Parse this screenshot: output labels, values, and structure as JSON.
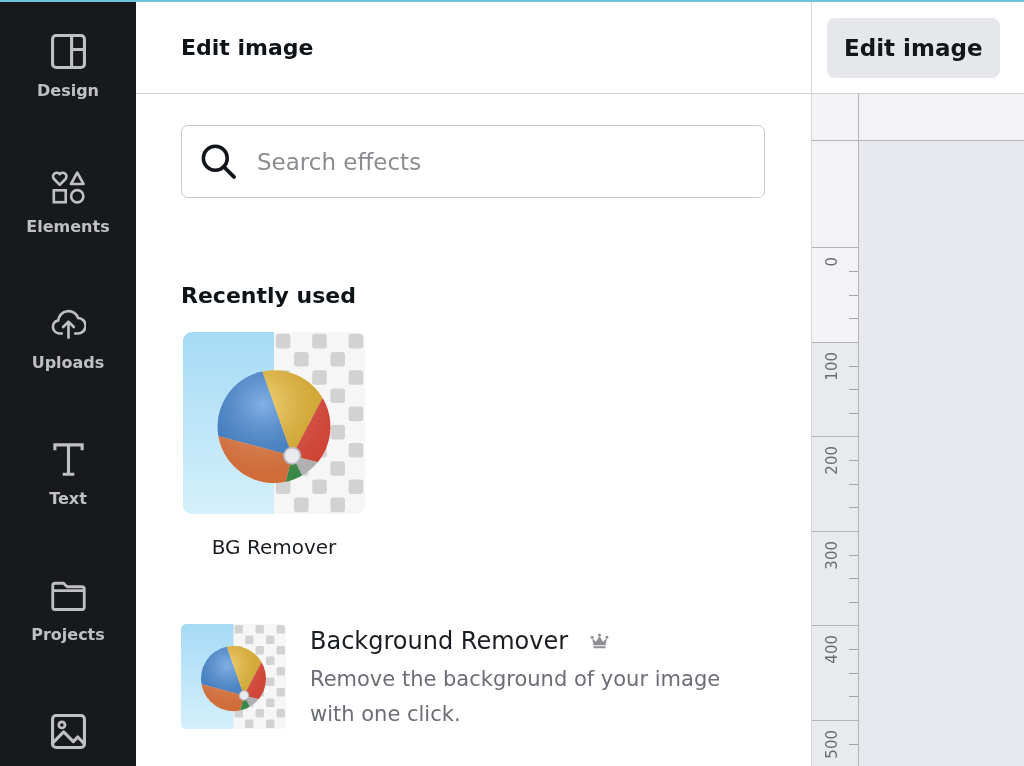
{
  "sidebar": {
    "items": [
      {
        "label": "Design",
        "selected": false
      },
      {
        "label": "Elements",
        "selected": false
      },
      {
        "label": "Uploads",
        "selected": false
      },
      {
        "label": "Text",
        "selected": false
      },
      {
        "label": "Projects",
        "selected": false
      },
      {
        "selected": false
      }
    ]
  },
  "panel": {
    "title": "Edit image",
    "search": {
      "placeholder": "Search effects"
    },
    "recently_used": {
      "heading": "Recently used",
      "items": [
        {
          "label": "BG Remover"
        }
      ]
    },
    "effects": [
      {
        "title": "Background Remover",
        "premium": true,
        "description": "Remove the background of your image with one click."
      }
    ]
  },
  "canvas": {
    "edit_button": "Edit image",
    "ruler_labels": [
      "0",
      "100",
      "200",
      "300",
      "400",
      "500"
    ]
  }
}
